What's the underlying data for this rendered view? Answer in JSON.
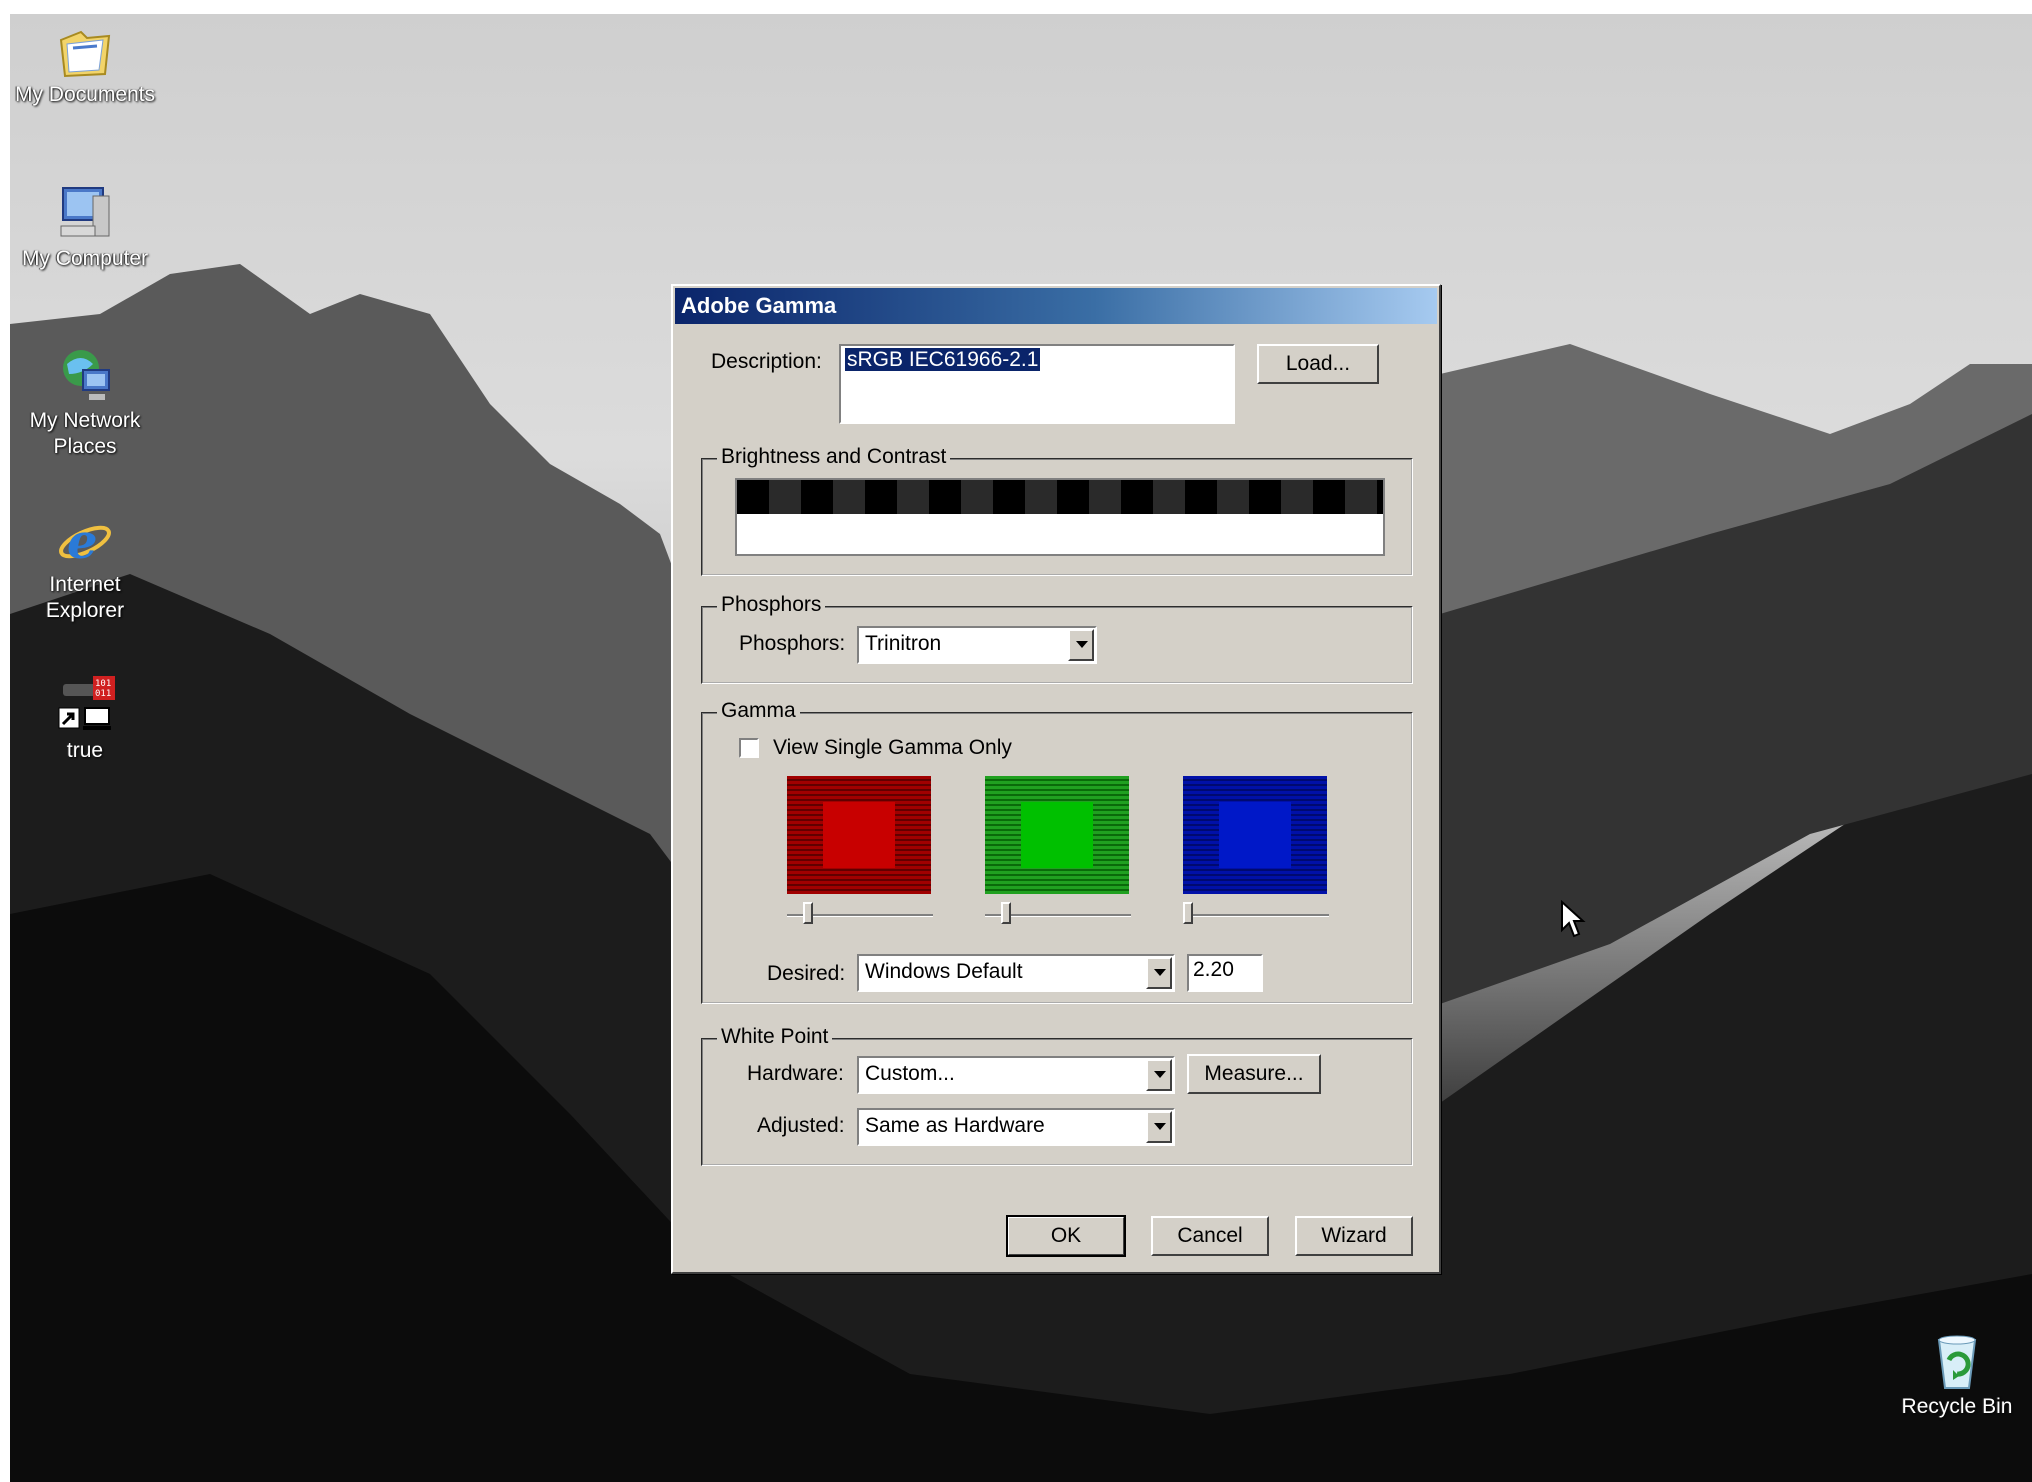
{
  "desktop": {
    "icons": [
      {
        "label": "My Documents",
        "icon": "my-documents-icon"
      },
      {
        "label": "My Computer",
        "icon": "my-computer-icon"
      },
      {
        "label": "My Network\nPlaces",
        "icon": "network-places-icon"
      },
      {
        "label": "Internet\nExplorer",
        "icon": "internet-explorer-icon"
      },
      {
        "label": "true",
        "icon": "shortcut-app-icon"
      }
    ],
    "recycle_bin": {
      "label": "Recycle Bin",
      "icon": "recycle-bin-icon"
    }
  },
  "dialog": {
    "title": "Adobe Gamma",
    "description_label": "Description:",
    "description_value": "sRGB IEC61966-2.1",
    "load_button": "Load...",
    "brightness_group": "Brightness and Contrast",
    "phosphors_group": "Phosphors",
    "phosphors_label": "Phosphors:",
    "phosphors_value": "Trinitron",
    "gamma_group": "Gamma",
    "single_gamma_label": "View Single Gamma Only",
    "single_gamma_checked": false,
    "desired_label": "Desired:",
    "desired_value": "Windows Default",
    "gamma_value": "2.20",
    "white_point_group": "White Point",
    "hardware_label": "Hardware:",
    "hardware_value": "Custom...",
    "measure_button": "Measure...",
    "adjusted_label": "Adjusted:",
    "adjusted_value": "Same as Hardware",
    "ok_button": "OK",
    "cancel_button": "Cancel",
    "wizard_button": "Wizard",
    "colors": {
      "red_swatch": "#a00000",
      "red_inner": "#c80000",
      "green_swatch": "#1a9a1a",
      "green_inner": "#00c000",
      "blue_swatch": "#0010a8",
      "blue_inner": "#0018c8"
    }
  }
}
